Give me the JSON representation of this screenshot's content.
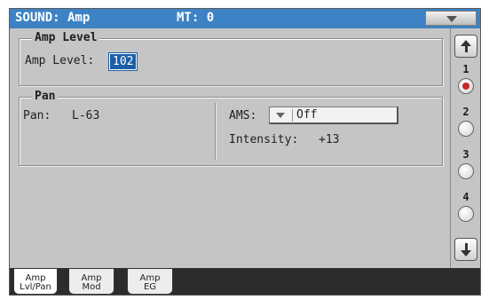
{
  "header": {
    "title": "SOUND: Amp",
    "mt": "MT: 0"
  },
  "amp_level": {
    "section_title": "Amp Level",
    "label": "Amp Level:",
    "value": "102"
  },
  "pan": {
    "section_title": "Pan",
    "label": "Pan:",
    "value": "L-63",
    "ams_label": "AMS:",
    "ams_value": "Off",
    "intensity_label": "Intensity:",
    "intensity_value": "+13"
  },
  "sidebar": {
    "pages": [
      "1",
      "2",
      "3",
      "4"
    ],
    "active_page": "1"
  },
  "tabs": [
    {
      "line1": "Amp",
      "line2": "Lvl/Pan",
      "active": true
    },
    {
      "line1": "Amp",
      "line2": "Mod",
      "active": false
    },
    {
      "line1": "Amp",
      "line2": "EG",
      "active": false
    }
  ],
  "colors": {
    "titlebar": "#3d82c4",
    "background": "#c5c5c5",
    "selection": "#1d5ea6",
    "active_indicator": "#c62828"
  }
}
